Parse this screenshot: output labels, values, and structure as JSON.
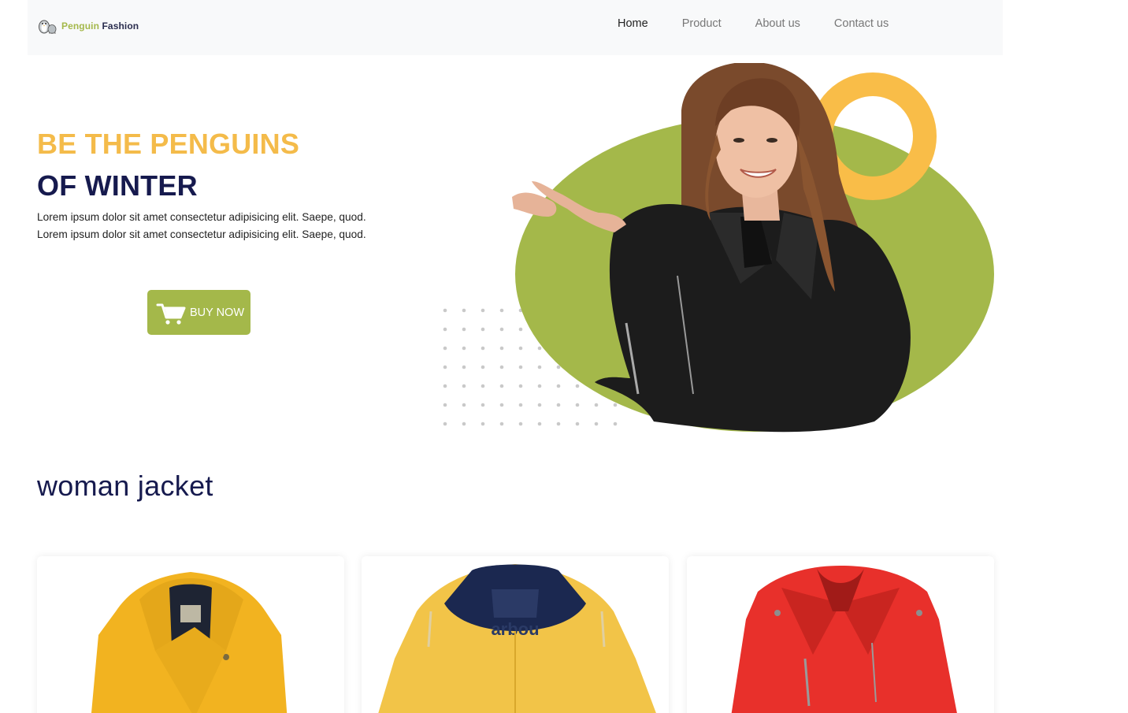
{
  "navbar": {
    "brand": {
      "part1": "Penguin",
      "part2": "Fashion",
      "logo_icon": "penguin-icon"
    },
    "links": [
      {
        "label": "Home",
        "active": true
      },
      {
        "label": "Product",
        "active": false
      },
      {
        "label": "About us",
        "active": false
      },
      {
        "label": "Contact us",
        "active": false
      }
    ]
  },
  "hero": {
    "title_line1": "BE THE PENGUINS",
    "title_line2": "OF WINTER",
    "desc_line1": "Lorem ipsum dolor sit amet consectetur adipisicing elit. Saepe, quod.",
    "desc_line2": "Lorem ipsum dolor sit amet consectetur adipisicing elit. Saepe, quod.",
    "button_label": "BUY NOW",
    "button_icon": "cart-icon"
  },
  "section": {
    "title": "woman jacket",
    "products": [
      {
        "image": "yellow-coat-image"
      },
      {
        "image": "yellow-raincoat-image"
      },
      {
        "image": "red-leather-jacket-image"
      }
    ]
  },
  "colors": {
    "accent_green": "#a4b84a",
    "accent_yellow": "#f4bb4a",
    "navy": "#161a4e",
    "navbar_bg": "#f8f9fa"
  }
}
